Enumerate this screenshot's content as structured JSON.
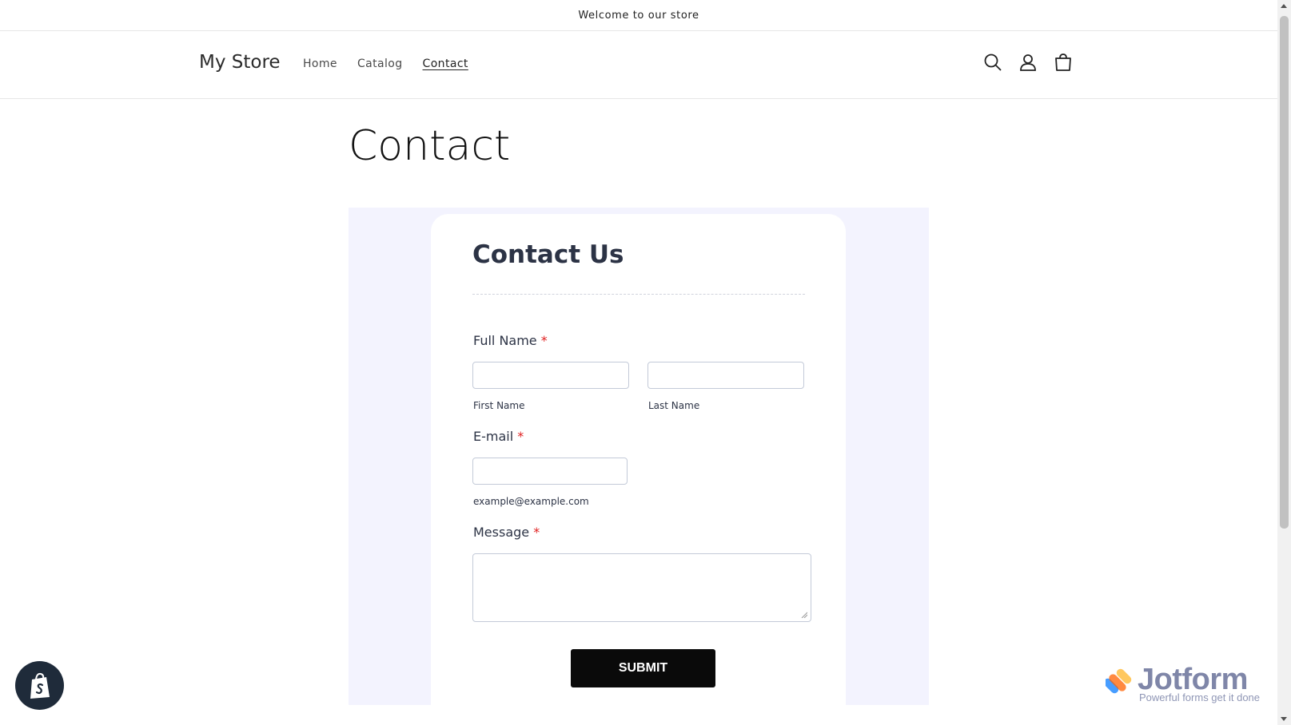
{
  "announcement": "Welcome to our store",
  "header": {
    "logo": "My Store",
    "nav": [
      "Home",
      "Catalog",
      "Contact"
    ]
  },
  "page": {
    "title": "Contact"
  },
  "form": {
    "heading": "Contact Us",
    "full_name_label": "Full Name",
    "first_name_sublabel": "First Name",
    "last_name_sublabel": "Last Name",
    "email_label": "E-mail",
    "email_sublabel": "example@example.com",
    "message_label": "Message",
    "required_mark": "*",
    "submit_label": "SUBMIT"
  },
  "jotform": {
    "brand": "Jotform",
    "tagline": "Powerful forms get it done"
  },
  "icons": [
    "search-icon",
    "account-icon",
    "cart-icon",
    "shopify-icon",
    "jotform-logo-icon"
  ],
  "colors": {
    "form_background": "#f3f3fe",
    "submit": "#0a0a0a",
    "required": "#e02020",
    "text_dark": "#2c3345"
  }
}
